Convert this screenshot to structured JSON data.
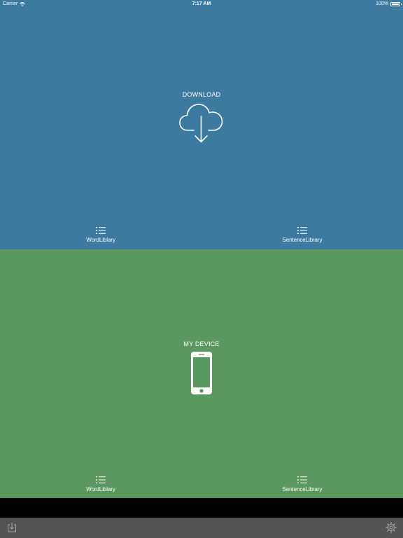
{
  "status_bar": {
    "carrier": "Carrier",
    "time": "7:17 AM",
    "battery": "100%"
  },
  "download_panel": {
    "title": "DOWNLOAD",
    "icon": "cloud-download-icon",
    "color": "#3c7aa0",
    "word_library_label": "WordLiblary",
    "sentence_library_label": "SentenceLibrary"
  },
  "device_panel": {
    "title": "MY DEVICE",
    "icon": "phone-icon",
    "color": "#5a9860",
    "word_library_label": "WordLiblary",
    "sentence_library_label": "SentenceLibrary"
  },
  "toolbar": {
    "left_icon": "download-tray-icon",
    "right_icon": "gear-icon",
    "color": "#535353"
  }
}
